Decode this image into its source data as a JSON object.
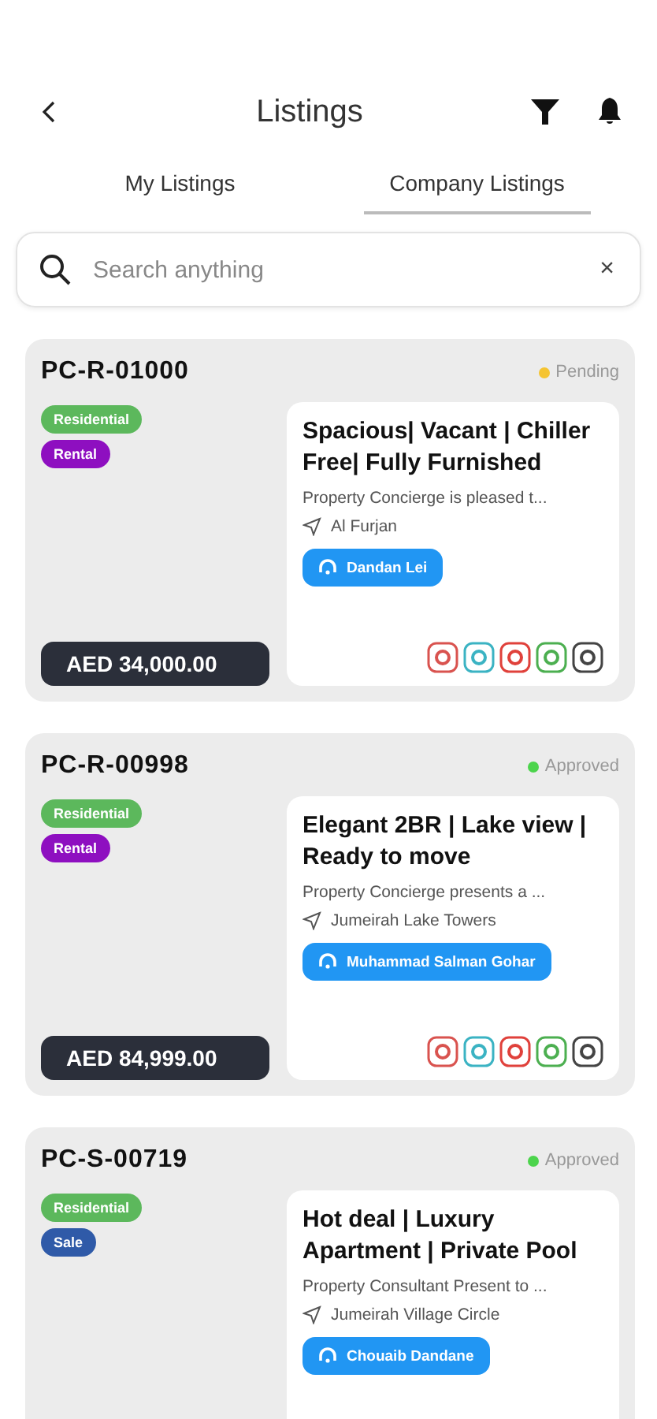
{
  "header": {
    "title": "Listings"
  },
  "tabs": [
    {
      "label": "My Listings",
      "selected": false
    },
    {
      "label": "Company Listings",
      "selected": true
    }
  ],
  "search": {
    "placeholder": "Search anything",
    "clear": "×"
  },
  "listings": [
    {
      "ref": "PC-R-01000",
      "status": {
        "label": "Pending",
        "color": "#f5c431"
      },
      "tags": [
        {
          "label": "Residential",
          "color": "#5cb85c"
        },
        {
          "label": "Rental",
          "color": "#8e0fc0"
        }
      ],
      "price": "AED  34,000.00",
      "title": "Spacious| Vacant | Chiller Free| Fully Furnished",
      "description": "Property Concierge is pleased t...",
      "location": "Al Furjan",
      "agent": "Dandan Lei",
      "portals": [
        {
          "color": "#d9534f"
        },
        {
          "color": "#3bb3c3"
        },
        {
          "color": "#e0413b"
        },
        {
          "color": "#4caf50"
        },
        {
          "color": "#444444"
        }
      ]
    },
    {
      "ref": "PC-R-00998",
      "status": {
        "label": "Approved",
        "color": "#4cd44c"
      },
      "tags": [
        {
          "label": "Residential",
          "color": "#5cb85c"
        },
        {
          "label": "Rental",
          "color": "#8e0fc0"
        }
      ],
      "price": "AED  84,999.00",
      "title": "Elegant 2BR | Lake view | Ready to move",
      "description": "Property Concierge presents a ...",
      "location": "Jumeirah Lake Towers",
      "agent": "Muhammad Salman Gohar",
      "portals": [
        {
          "color": "#d9534f"
        },
        {
          "color": "#3bb3c3"
        },
        {
          "color": "#e0413b"
        },
        {
          "color": "#4caf50"
        },
        {
          "color": "#444444"
        }
      ]
    },
    {
      "ref": "PC-S-00719",
      "status": {
        "label": "Approved",
        "color": "#4cd44c"
      },
      "tags": [
        {
          "label": "Residential",
          "color": "#5cb85c"
        },
        {
          "label": "Sale",
          "color": "#2f5aa8"
        }
      ],
      "title": "Hot deal | Luxury Apartment | Private Pool",
      "description": "Property Consultant Present to ...",
      "location": "Jumeirah Village Circle",
      "agent": "Chouaib Dandane"
    }
  ]
}
